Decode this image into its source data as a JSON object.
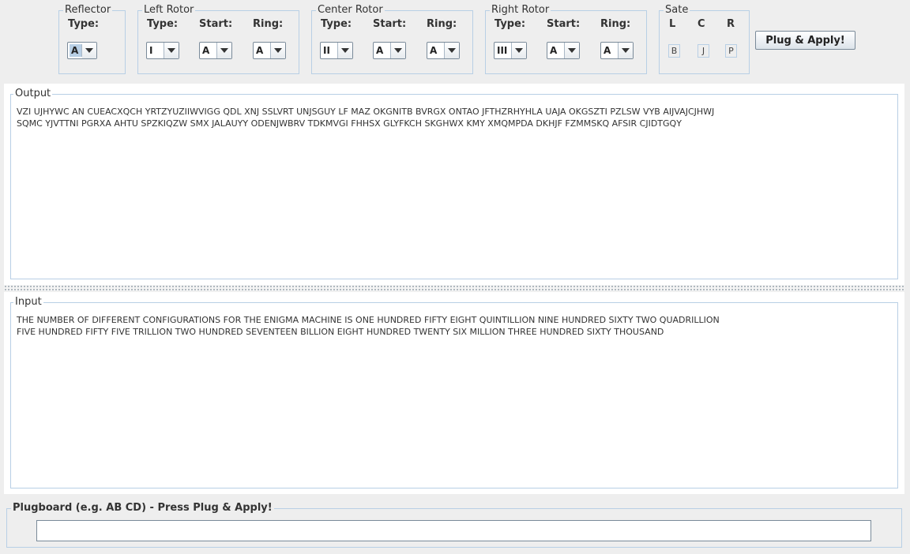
{
  "reflector": {
    "title": "Reflector",
    "type_label": "Type:",
    "type_value": "A"
  },
  "left_rotor": {
    "title": "Left Rotor",
    "type_label": "Type:",
    "start_label": "Start:",
    "ring_label": "Ring:",
    "type_value": "I",
    "start_value": "A",
    "ring_value": "A"
  },
  "center_rotor": {
    "title": "Center Rotor",
    "type_label": "Type:",
    "start_label": "Start:",
    "ring_label": "Ring:",
    "type_value": "II",
    "start_value": "A",
    "ring_value": "A"
  },
  "right_rotor": {
    "title": "Right Rotor",
    "type_label": "Type:",
    "start_label": "Start:",
    "ring_label": "Ring:",
    "type_value": "III",
    "start_value": "A",
    "ring_value": "A"
  },
  "sate": {
    "title": "Sate",
    "l_label": "L",
    "c_label": "C",
    "r_label": "R",
    "l_value": "B",
    "c_value": "J",
    "r_value": "P"
  },
  "plug_button": "Plug & Apply!",
  "output": {
    "title": "Output",
    "text": "VZI UJHYWC AN CUEACXQCH YRTZYUZIIWVIGG QDL XNJ SSLVRT UNJSGUY LF MAZ OKGNITB BVRGX ONTAO JFTHZRHYHLA UAJA OKGSZTI PZLSW VYB AIJVAJCJHWJ\nSQMC YJVTTNI PGRXA AHTU SPZKIQZW SMX JALAUYY ODENJWBRV TDKMVGI FHHSX GLYFKCH SKGHWX KMY XMQMPDA DKHJF FZMMSKQ AFSIR CJIDTGQY"
  },
  "input": {
    "title": "Input",
    "text": "THE NUMBER OF DIFFERENT CONFIGURATIONS FOR THE ENIGMA MACHINE IS ONE HUNDRED FIFTY EIGHT QUINTILLION NINE HUNDRED SIXTY TWO QUADRILLION\nFIVE HUNDRED FIFTY FIVE TRILLION TWO HUNDRED SEVENTEEN BILLION EIGHT HUNDRED TWENTY SIX MILLION THREE HUNDRED SIXTY THOUSAND"
  },
  "plugboard": {
    "title": "Plugboard (e.g. AB CD) - Press Plug & Apply!",
    "value": ""
  }
}
